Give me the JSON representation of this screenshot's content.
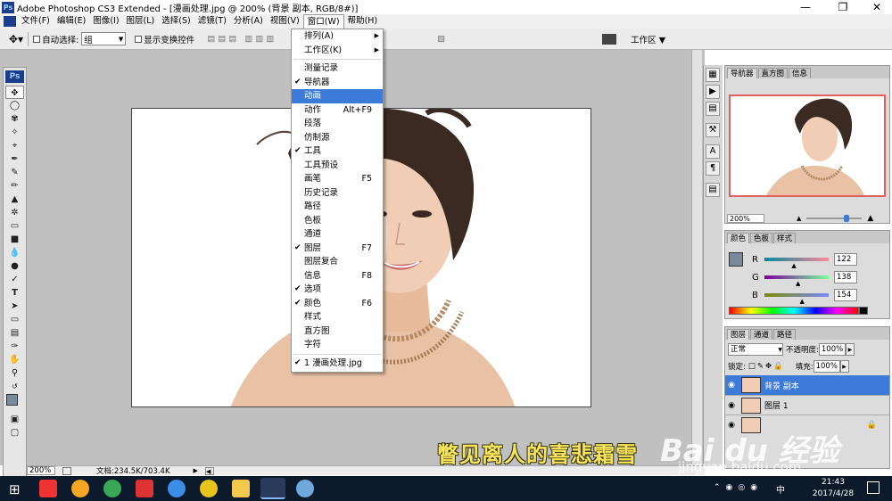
{
  "window": {
    "title": "Adobe Photoshop CS3 Extended - [漫画处理.jpg @ 200% (背景 副本, RGB/8#)]",
    "ps_badge": "Ps"
  },
  "menubar": {
    "items": [
      "文件(F)",
      "编辑(E)",
      "图像(I)",
      "图层(L)",
      "选择(S)",
      "滤镜(T)",
      "分析(A)",
      "视图(V)",
      "窗口(W)",
      "帮助(H)"
    ],
    "active": "窗口(W)"
  },
  "options": {
    "auto_select_label": "自动选择:",
    "auto_select_value": "组",
    "show_transform_label": "显示变换控件",
    "workspace_label": "工作区"
  },
  "window_menu": {
    "items": [
      {
        "label": "排列(A)",
        "submenu": true
      },
      {
        "label": "工作区(K)",
        "submenu": true
      },
      {
        "sep": true
      },
      {
        "label": "测量记录"
      },
      {
        "label": "导航器",
        "checked": true
      },
      {
        "label": "动画",
        "highlight": true
      },
      {
        "label": "动作",
        "shortcut": "Alt+F9"
      },
      {
        "label": "段落"
      },
      {
        "label": "仿制源"
      },
      {
        "label": "工具",
        "checked": true
      },
      {
        "label": "工具预设"
      },
      {
        "label": "画笔",
        "shortcut": "F5"
      },
      {
        "label": "历史记录"
      },
      {
        "label": "路径"
      },
      {
        "label": "色板"
      },
      {
        "label": "通道"
      },
      {
        "label": "图层",
        "checked": true,
        "shortcut": "F7"
      },
      {
        "label": "图层复合"
      },
      {
        "label": "信息",
        "shortcut": "F8"
      },
      {
        "label": "选项",
        "checked": true
      },
      {
        "label": "颜色",
        "checked": true,
        "shortcut": "F6"
      },
      {
        "label": "样式"
      },
      {
        "label": "直方图"
      },
      {
        "label": "字符"
      },
      {
        "sep": true
      },
      {
        "label": "1 漫画处理.jpg",
        "checked": true
      }
    ]
  },
  "navigator": {
    "tabs": [
      "导航器",
      "直方图",
      "信息"
    ],
    "zoom": "200%"
  },
  "color_panel": {
    "tabs": [
      "颜色",
      "色板",
      "样式"
    ],
    "r_label": "R",
    "g_label": "G",
    "b_label": "B",
    "r": "122",
    "g": "138",
    "b": "154",
    "r_frac": 0.478,
    "g_frac": 0.541,
    "b_frac": 0.604,
    "swatch_color": "#7a8a9a"
  },
  "layers_panel": {
    "tabs": [
      "图层",
      "通道",
      "路径"
    ],
    "blend_mode": "正常",
    "opacity_label": "不透明度:",
    "opacity": "100%",
    "lock_label": "锁定:",
    "fill_label": "填充:",
    "fill": "100%",
    "layers": [
      {
        "name": "背景 副本",
        "selected": true
      },
      {
        "name": "图层 1",
        "selected": false
      },
      {
        "name": "",
        "selected": false
      }
    ]
  },
  "status": {
    "zoom": "200%",
    "doc": "文档:234.5K/703.4K"
  },
  "subtitle": "瞥见离人的喜悲霜雪",
  "watermark": {
    "main": "Bai du 经验",
    "url": "jingyan.baidu.com"
  },
  "taskbar": {
    "time": "21:43",
    "date": "2017/4/28",
    "ime": "中"
  },
  "colors": {
    "accent": "#3d7bd8",
    "taskbar": "#0d1a2b",
    "subtitle": "#f7e45c"
  }
}
